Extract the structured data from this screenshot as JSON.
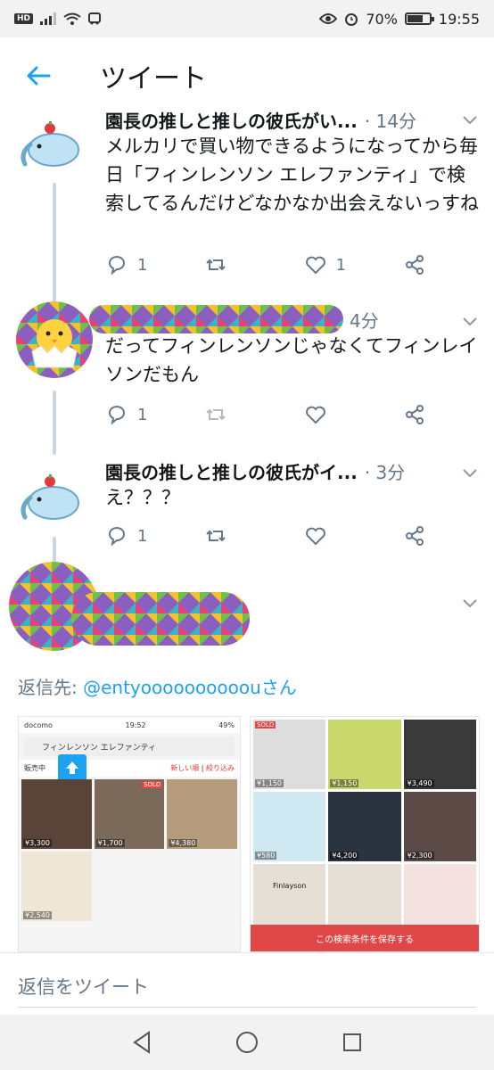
{
  "status_bar": {
    "hd": "HD",
    "battery": "70%",
    "battery_level": 0.7,
    "time": "19:55"
  },
  "header": {
    "title": "ツイート"
  },
  "tweets": [
    {
      "name": "園長の推しと推しの彼氏がい...",
      "time": "· 14分",
      "text": "メルカリで買い物できるようになってから毎日「フィンレンソン エレファンティ」で検索してるんだけどなかなか出会えないっすね",
      "reply_count": "1",
      "like_count": "1"
    },
    {
      "name": "",
      "time": "4分",
      "text": "だってフィンレンソンじゃなくてフィンレイソンだもん",
      "reply_count": "1",
      "like_count": ""
    },
    {
      "name": "園長の推しと推しの彼氏がイ...",
      "time": "· 3分",
      "text": "え？？？",
      "reply_count": "1",
      "like_count": ""
    }
  ],
  "reply_to": {
    "prefix": "返信先: ",
    "handle": "@entyoooooooooou",
    "suffix": "さん"
  },
  "media": {
    "left": {
      "carrier": "docomo",
      "time": "19:52",
      "battery": "49%",
      "search_query": "フィンレンソン エレファンティ",
      "filter_label": "販売中",
      "sort_new": "新しい順",
      "refine": "絞り込み",
      "prices": [
        "¥3,300",
        "¥1,700",
        "¥4,380",
        "¥2,540"
      ],
      "sold": "SOLD"
    },
    "right": {
      "prices": [
        "¥1,150",
        "¥1,150",
        "¥3,490",
        "¥580",
        "¥4,200",
        "¥2,300"
      ],
      "sold": "SOLD",
      "save_label": "この検索条件を保存する",
      "brand": "Finlayson"
    }
  },
  "reply_bar": {
    "placeholder": "返信をツイート"
  },
  "colors": {
    "accent": "#1da1f2",
    "text_secondary": "#657786",
    "sold_red": "#e04848"
  },
  "icons": {
    "back": "arrow-left-icon",
    "reply": "reply-bubble-icon",
    "retweet": "retweet-icon",
    "like": "heart-icon",
    "share": "share-icon",
    "caret": "chevron-down-icon"
  }
}
